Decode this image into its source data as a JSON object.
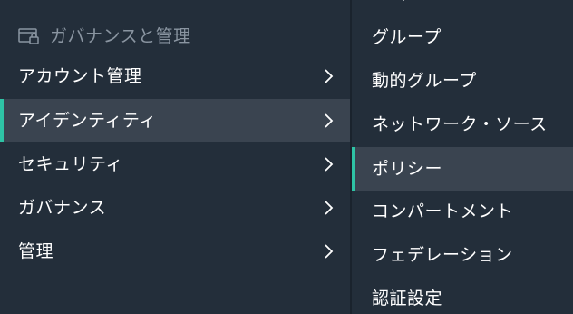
{
  "section": {
    "title": "ガバナンスと管理",
    "icon": "governance-lock-icon"
  },
  "menu": {
    "items": [
      {
        "label": "アカウント管理",
        "active": false
      },
      {
        "label": "アイデンティティ",
        "active": true
      },
      {
        "label": "セキュリティ",
        "active": false
      },
      {
        "label": "ガバナンス",
        "active": false
      },
      {
        "label": "管理",
        "active": false
      }
    ]
  },
  "submenu": {
    "items": [
      {
        "label": "グループ",
        "active": false
      },
      {
        "label": "動的グループ",
        "active": false
      },
      {
        "label": "ネットワーク・ソース",
        "active": false
      },
      {
        "label": "ポリシー",
        "active": true
      },
      {
        "label": "コンパートメント",
        "active": false
      },
      {
        "label": "フェデレーション",
        "active": false
      },
      {
        "label": "認証設定",
        "active": false
      }
    ]
  },
  "colors": {
    "background": "#232e3a",
    "active_background": "#3a4450",
    "accent": "#2ec3a5",
    "header_text": "#8a95a1",
    "text": "#ffffff"
  }
}
